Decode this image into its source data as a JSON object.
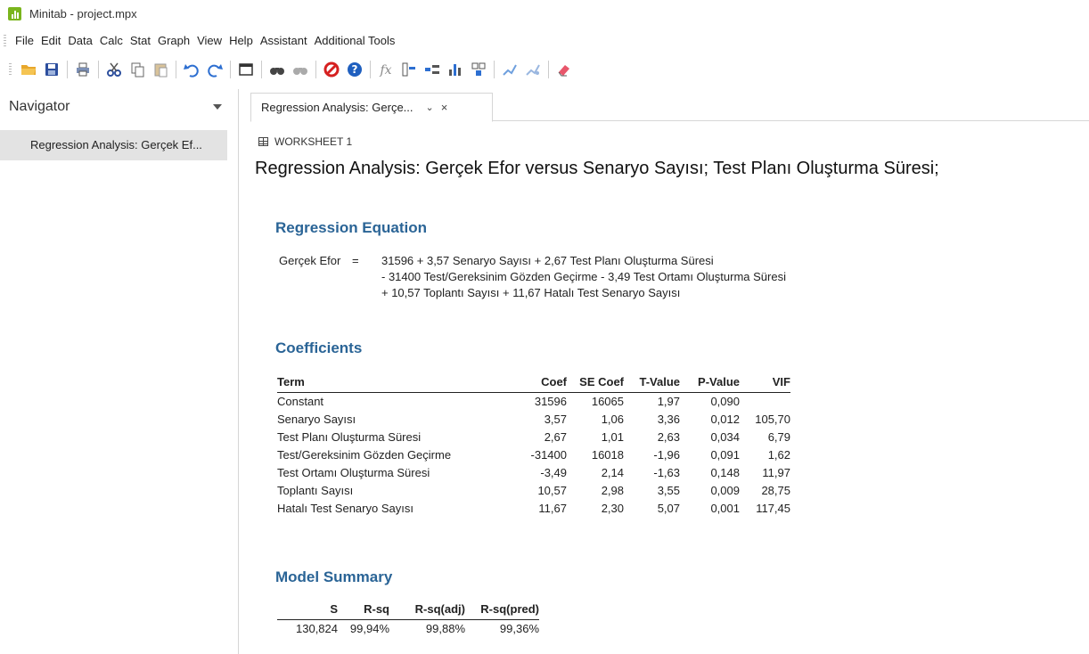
{
  "window": {
    "title": "Minitab - project.mpx"
  },
  "menu": [
    "File",
    "Edit",
    "Data",
    "Calc",
    "Stat",
    "Graph",
    "View",
    "Help",
    "Assistant",
    "Additional Tools"
  ],
  "toolbar": {
    "icons": [
      "open-folder-icon",
      "save-icon",
      "print-icon",
      "cut-icon",
      "copy-icon",
      "paste-icon",
      "undo-icon",
      "redo-icon",
      "window-icon",
      "find-icon",
      "replace-icon",
      "cancel-icon",
      "help-icon",
      "function-icon",
      "column-icon",
      "row-icon",
      "chart-icon",
      "layout-icon",
      "brush-icon",
      "edit-graph-icon",
      "eraser-icon"
    ]
  },
  "navigator": {
    "title": "Navigator",
    "items": [
      {
        "label": "Regression Analysis: Gerçek Ef..."
      }
    ]
  },
  "tab": {
    "label": "Regression Analysis: Gerçe...",
    "chevron": "⌄",
    "close": "×"
  },
  "content": {
    "worksheet": "WORKSHEET 1",
    "title": "Regression Analysis: Gerçek Efor versus Senaryo Sayısı; Test Planı Oluşturma Süresi;",
    "equation": {
      "heading": "Regression Equation",
      "lhs": "Gerçek Efor",
      "eq": "=",
      "lines": [
        "31596 + 3,57 Senaryo Sayısı + 2,67 Test Planı Oluşturma Süresi",
        "- 31400 Test/Gereksinim Gözden Geçirme - 3,49 Test Ortamı Oluşturma Süresi",
        "+ 10,57 Toplantı Sayısı + 11,67 Hatalı Test Senaryo Sayısı"
      ]
    },
    "coefficients": {
      "heading": "Coefficients",
      "headers": [
        "Term",
        "Coef",
        "SE Coef",
        "T-Value",
        "P-Value",
        "VIF"
      ],
      "rows": [
        [
          "Constant",
          "31596",
          "16065",
          "1,97",
          "0,090",
          ""
        ],
        [
          "Senaryo Sayısı",
          "3,57",
          "1,06",
          "3,36",
          "0,012",
          "105,70"
        ],
        [
          "Test Planı Oluşturma Süresi",
          "2,67",
          "1,01",
          "2,63",
          "0,034",
          "6,79"
        ],
        [
          "Test/Gereksinim Gözden Geçirme",
          "-31400",
          "16018",
          "-1,96",
          "0,091",
          "1,62"
        ],
        [
          "Test Ortamı Oluşturma Süresi",
          "-3,49",
          "2,14",
          "-1,63",
          "0,148",
          "11,97"
        ],
        [
          "Toplantı Sayısı",
          "10,57",
          "2,98",
          "3,55",
          "0,009",
          "28,75"
        ],
        [
          "Hatalı Test Senaryo Sayısı",
          "11,67",
          "2,30",
          "5,07",
          "0,001",
          "117,45"
        ]
      ]
    },
    "model_summary": {
      "heading": "Model Summary",
      "headers": [
        "S",
        "R-sq",
        "R-sq(adj)",
        "R-sq(pred)"
      ],
      "row": [
        "130,824",
        "99,94%",
        "99,88%",
        "99,36%"
      ]
    }
  }
}
